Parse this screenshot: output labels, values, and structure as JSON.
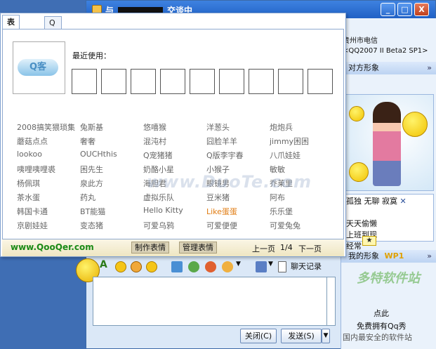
{
  "window": {
    "title_prefix": "与",
    "title_suffix": "交谈中",
    "min_label": "_",
    "max_label": "□",
    "close_label": "X"
  },
  "right_panel": {
    "location": "贵州市电信",
    "client": "<QQ2007 II Beta2 SP1>",
    "peer_title": "对方形象",
    "chevron": "»",
    "ad_line1": [
      "孤独",
      "无聊",
      "寂寞"
    ],
    "ad_close": "✕",
    "ad_line2": "天天偷懒",
    "ad_line3": "上班到现",
    "ad_line4": "经常",
    "my_title": "我的形象",
    "my_badge": "WP1",
    "click_here": "点此",
    "free_qq": "免费拥有Qq秀",
    "wm_brand": "多特软件站",
    "wm_tag": "国内最安全的软件站"
  },
  "popup": {
    "tabs": [
      "表情大全",
      "Q客表情"
    ],
    "logo_text": "Q客",
    "recent_label": "最近使用：",
    "watermark": "www.DuoTe.com",
    "rows": [
      [
        "2008搞笑猥琐集",
        "兔斯基",
        "悠嘻猴",
        "洋葱头",
        "炮炮兵"
      ],
      [
        "蘑菇点点",
        "奢奢",
        "混沌村",
        "囧脸羊羊",
        "jimmy困困"
      ],
      [
        "lookoo",
        "OUCHthis",
        "Q宠猪猪",
        "Q版李宇春",
        "八爪娃娃"
      ],
      [
        "咦哩咦哩裘",
        "困先生",
        "奶酪小星",
        "小猴子",
        "敏敏"
      ],
      [
        "杨佩琪",
        "泉此方",
        "海胆君",
        "眼镜男",
        "乔莱里"
      ],
      [
        "茶水蛋",
        "药丸",
        "虚拟乐队",
        "豆米猪",
        "阿布"
      ],
      [
        "韩国卡通",
        "BT能猫",
        "Hello Kitty",
        "Like蛋蛋",
        "乐乐堡"
      ],
      [
        "京剧娃娃",
        "变态猪",
        "可爱乌鸦",
        "可爱便便",
        "可爱兔兔"
      ]
    ],
    "site": "www.QooQer.com",
    "make_btn": "制作表情",
    "manage_btn": "管理表情",
    "prev": "上一页",
    "page": "1/4",
    "next": "下一页"
  },
  "toolbar": {
    "font_label": "A",
    "history_label": "聊天记录"
  },
  "buttons": {
    "close": "关闭(C)",
    "send": "发送(S)"
  }
}
